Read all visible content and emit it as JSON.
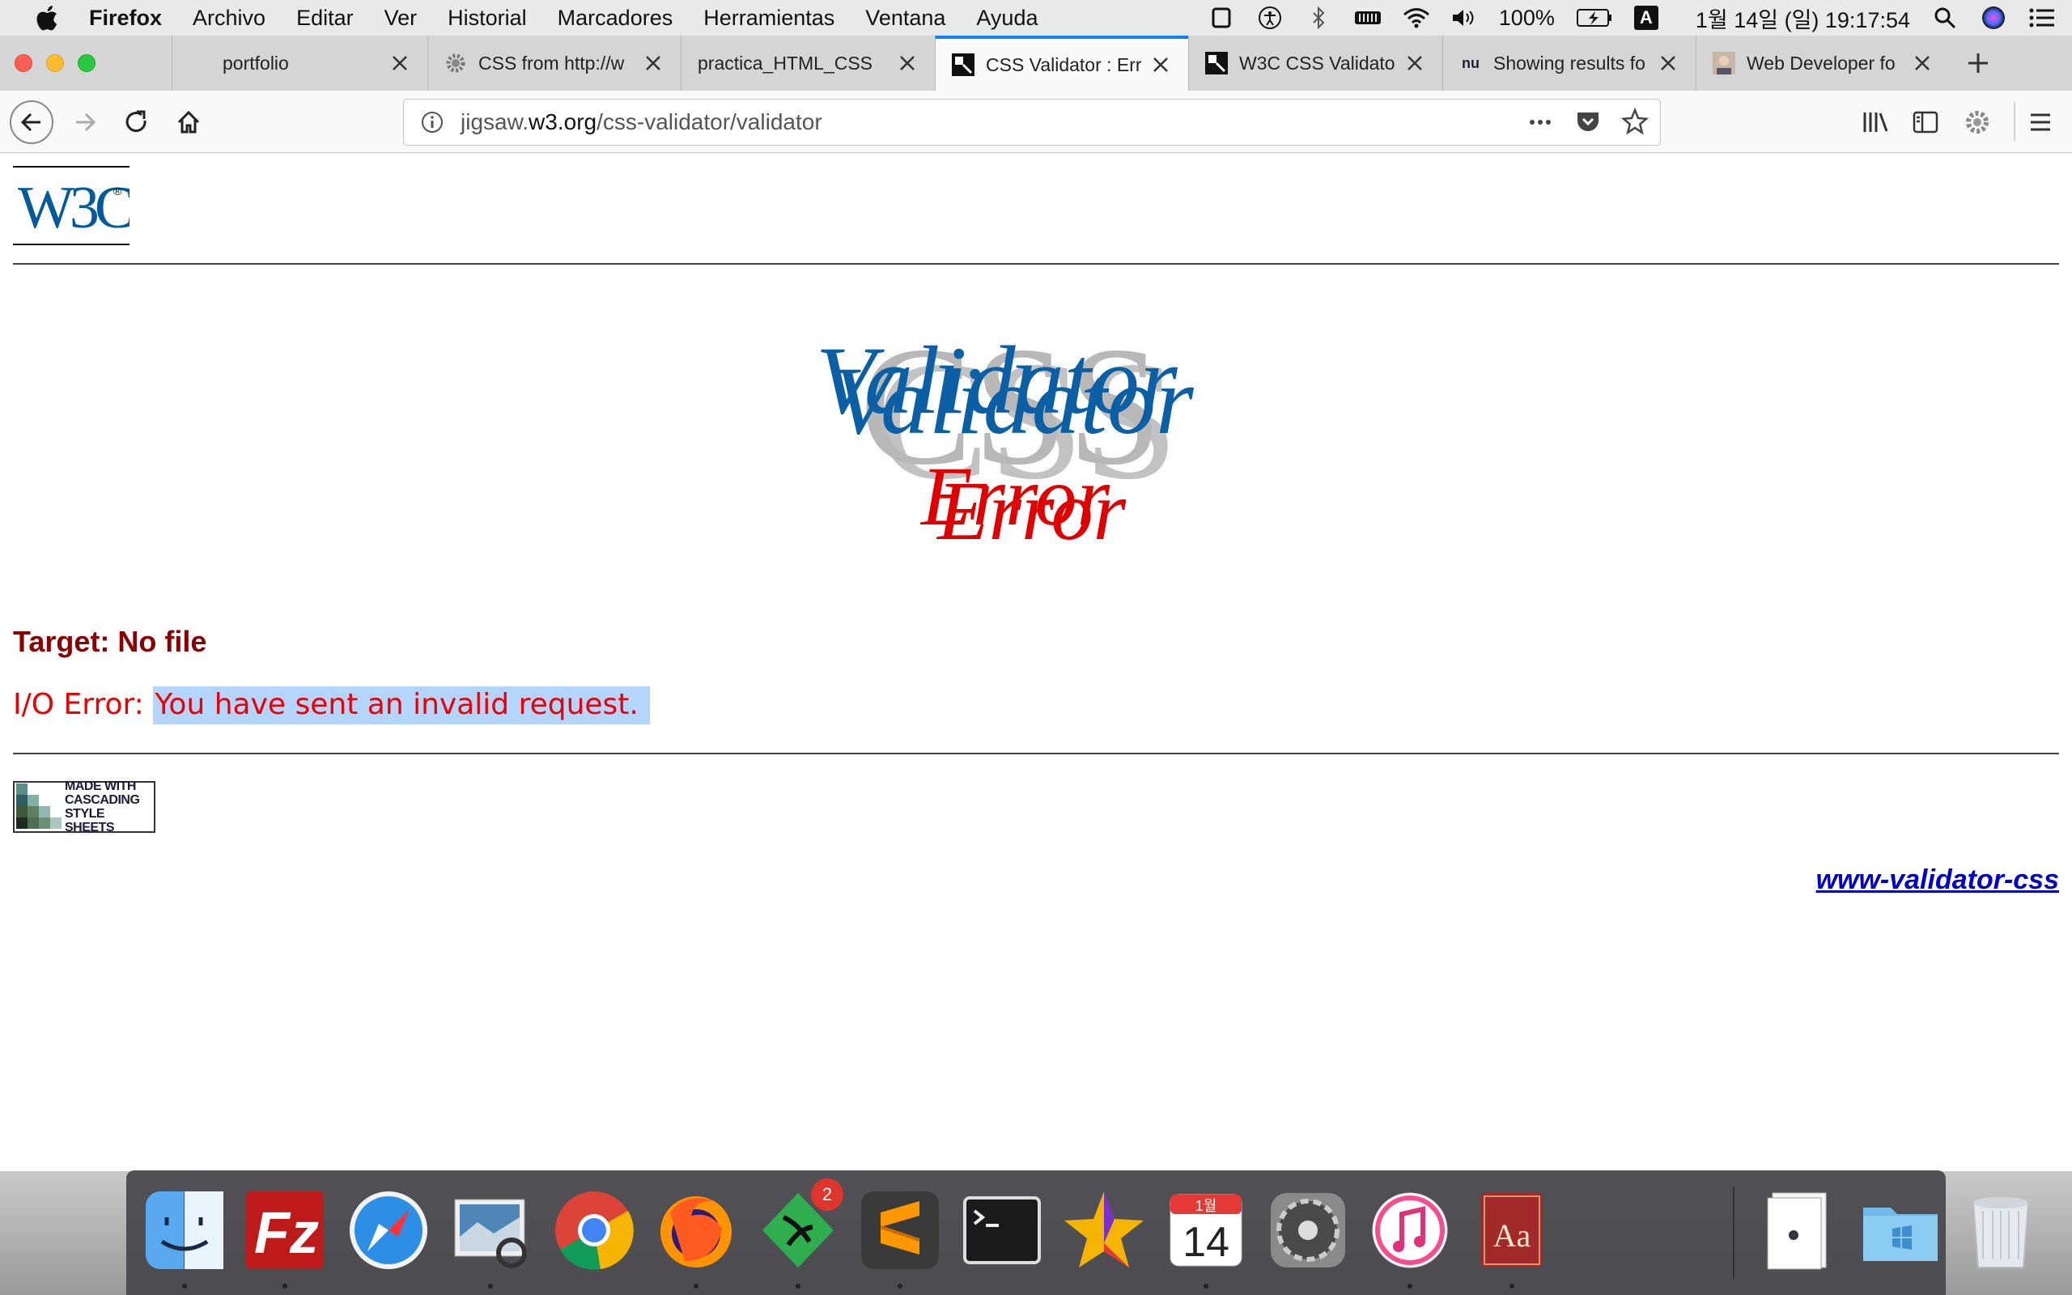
{
  "menubar": {
    "items": [
      "Firefox",
      "Archivo",
      "Editar",
      "Ver",
      "Historial",
      "Marcadores",
      "Herramientas",
      "Ventana",
      "Ayuda"
    ],
    "battery": "100%",
    "input_source": "A",
    "datetime": "1월 14일 (일)  19:17:54"
  },
  "tabs": [
    {
      "label": "portfolio",
      "favicon": "none"
    },
    {
      "label": "CSS from http://w",
      "favicon": "gear-icon"
    },
    {
      "label": "practica_HTML_CSS",
      "favicon": "none"
    },
    {
      "label": "CSS Validator : Err",
      "favicon": "w3c-favicon",
      "active": true
    },
    {
      "label": "W3C CSS Validato",
      "favicon": "w3c-favicon"
    },
    {
      "label": "Showing results fo",
      "favicon": "nu-icon"
    },
    {
      "label": "Web Developer fo",
      "favicon": "avatar-icon"
    }
  ],
  "urlbar": {
    "prefix": "jigsaw.",
    "host": "w3.org",
    "path": "/css-validator/validator"
  },
  "page": {
    "logo_text": "W3C",
    "banner_css": "CSS",
    "banner_validator": "Validator",
    "banner_error": "Error",
    "target_text": "Target: No file",
    "io_label": "I/O Error: ",
    "io_message": "You have sent an invalid request.",
    "badge_lines": [
      "MADE WITH",
      "CASCADING",
      "STYLE SHEETS"
    ],
    "footer_link": "www-validator-css"
  },
  "dock": {
    "apps": [
      "finder",
      "filezilla",
      "safari",
      "preview",
      "chrome",
      "firefox",
      "kite",
      "sublime-text",
      "terminal",
      "starred",
      "calendar",
      "system-preferences",
      "itunes",
      "dictionary"
    ],
    "kite_badge": "2",
    "calendar_month": "1월",
    "calendar_day": "14",
    "dictionary_label": "Aa"
  },
  "colors": {
    "accent": "#0a84ff",
    "error_red": "#e00000",
    "target_red": "#8b0000",
    "validator_blue": "#0b5fa5",
    "selection": "#b4d5fe"
  }
}
